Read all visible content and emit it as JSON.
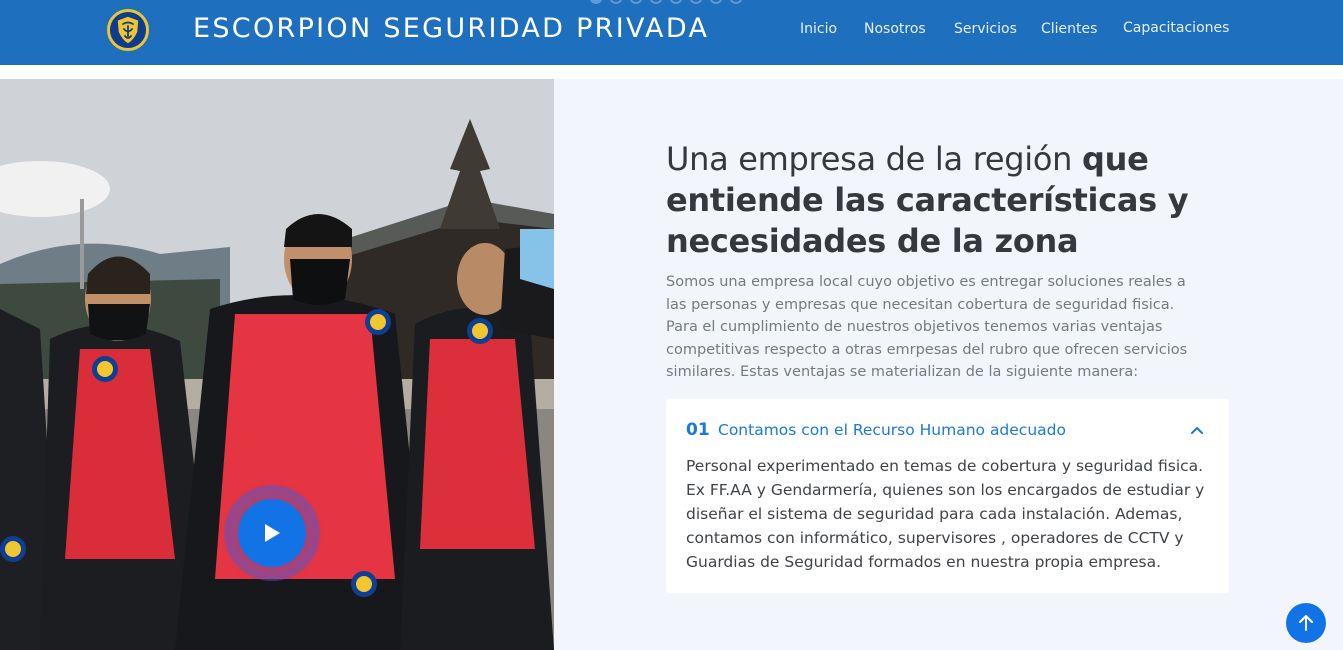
{
  "header": {
    "brand": "ESCORPION SEGURIDAD PRIVADA",
    "logo_icon": "scorpion-shield-logo-icon",
    "nav": [
      {
        "label": "Inicio"
      },
      {
        "label": "Nosotros"
      },
      {
        "label": "Servicios"
      },
      {
        "label": "Clientes"
      },
      {
        "label": "Capacitaciones"
      }
    ],
    "background_color": "#1f6fbf"
  },
  "hero_video": {
    "play_icon": "play-icon",
    "accent_color": "#1273e6"
  },
  "about": {
    "title_light": "Una empresa de la región ",
    "title_bold": "que entiende las características y necesidades de la zona",
    "description": "Somos una empresa local cuyo objetivo es entregar soluciones reales a las personas y empresas que necesitan cobertura de seguridad fisica. Para el cumplimiento de nuestros objetivos tenemos varias ventajas competitivas respecto a otras emrpesas del rubro que ofrecen servicios similares. Estas ventajas se materializan de la siguiente manera:"
  },
  "accordion": {
    "items": [
      {
        "number": "01",
        "title": "Contamos con el Recurso Humano adecuado",
        "body": "Personal experimentado en temas de cobertura y seguridad fisica. Ex FF.AA y Gendarmería, quienes son los encargados de estudiar y diseñar el sistema de seguridad para cada instalación. Ademas, contamos con informático, supervisores , operadores de CCTV y Guardias de Seguridad formados en nuestra propia empresa.",
        "expanded": true,
        "icon": "chevron-up-icon"
      }
    ]
  },
  "back_to_top": {
    "icon": "arrow-up-icon"
  }
}
